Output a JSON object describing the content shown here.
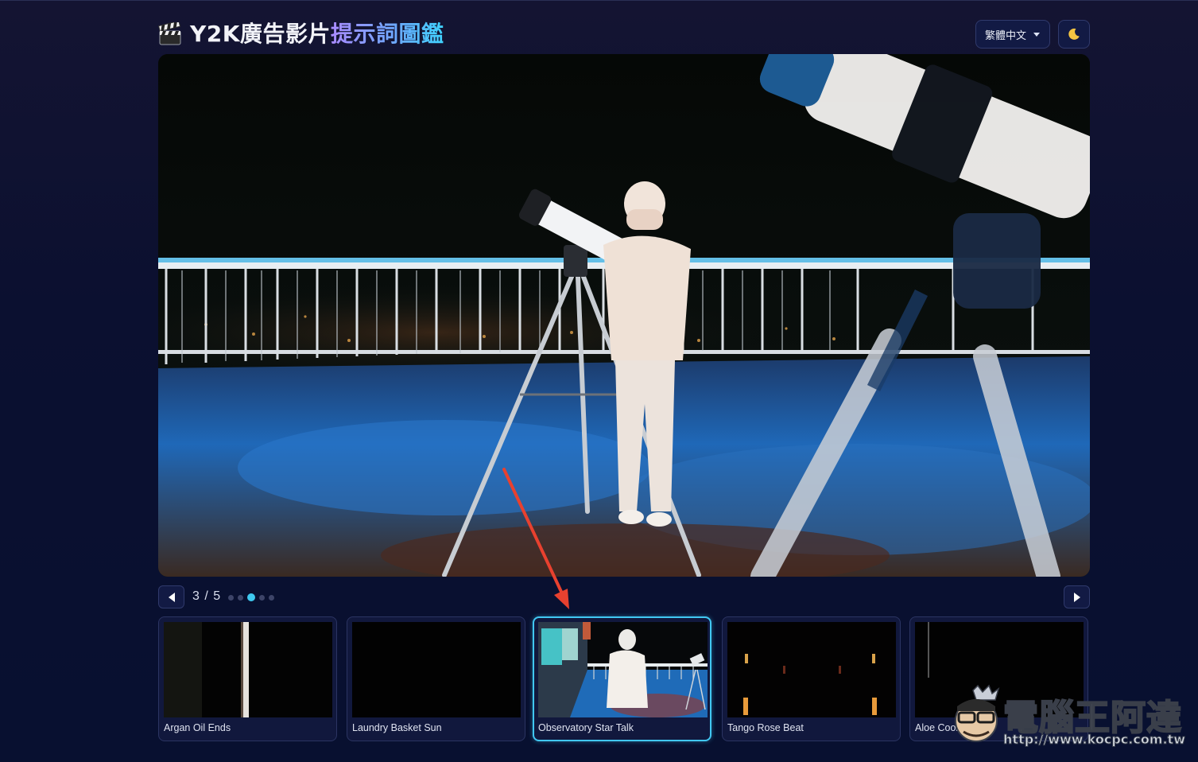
{
  "header": {
    "title_plain": "Y2K廣告影片",
    "title_highlight": "提示詞圖鑑",
    "title_icon": "clapperboard-icon",
    "language_selected": "繁體中文",
    "theme_icon": "moon-icon"
  },
  "carousel": {
    "counter": "3 / 5",
    "current": 3,
    "total": 5,
    "prev_icon": "triangle-left-icon",
    "next_icon": "triangle-right-icon"
  },
  "thumbnails": [
    {
      "caption": "Argan Oil Ends",
      "active": false
    },
    {
      "caption": "Laundry Basket Sun",
      "active": false
    },
    {
      "caption": "Observatory Star Talk",
      "active": true
    },
    {
      "caption": "Tango Rose Beat",
      "active": false
    },
    {
      "caption": "Aloe Cool Calm",
      "active": false
    }
  ],
  "watermark": {
    "text": "電腦王阿達",
    "url": "http://www.kocpc.com.tw"
  },
  "colors": {
    "accent": "#41c7f2",
    "title_gradient_start": "#a98bff",
    "title_gradient_end": "#3fd3ff",
    "annotation_arrow": "#e8412f"
  }
}
